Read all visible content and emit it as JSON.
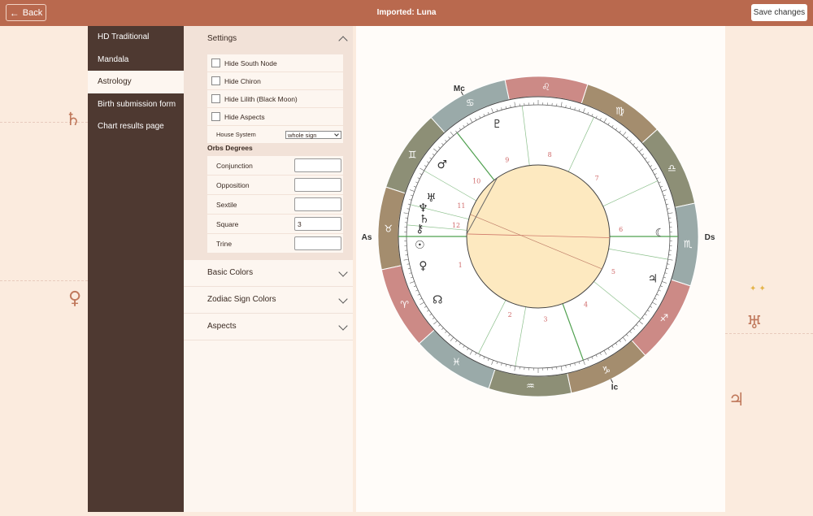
{
  "header": {
    "back_label": "Back",
    "title": "Imported: Luna",
    "save_label": "Save changes"
  },
  "nav": {
    "items": [
      {
        "label": "HD Traditional"
      },
      {
        "label": "Mandala"
      },
      {
        "label": "Astrology"
      },
      {
        "label": "Birth submission form"
      },
      {
        "label": "Chart results page"
      }
    ]
  },
  "settings": {
    "title": "Settings",
    "checkboxes": [
      {
        "label": "Hide South Node",
        "checked": false
      },
      {
        "label": "Hide Chiron",
        "checked": false
      },
      {
        "label": "Hide Lilith (Black Moon)",
        "checked": false
      },
      {
        "label": "Hide Aspects",
        "checked": false
      }
    ],
    "house_system_label": "House System",
    "house_system_value": "whole sign",
    "orbs_title": "Orbs Degrees",
    "orbs": [
      {
        "label": "Conjunction",
        "value": ""
      },
      {
        "label": "Opposition",
        "value": ""
      },
      {
        "label": "Sextile",
        "value": ""
      },
      {
        "label": "Square",
        "value": "3"
      },
      {
        "label": "Trine",
        "value": ""
      }
    ]
  },
  "sections": [
    {
      "label": "Basic Colors"
    },
    {
      "label": "Zodiac Sign Colors"
    },
    {
      "label": "Aspects"
    }
  ],
  "chart": {
    "angles": {
      "as": "As",
      "ds": "Ds",
      "mc": "Mc",
      "ic": "Ic"
    },
    "signs": [
      {
        "glyph": "♎",
        "color": "#8d8f76"
      },
      {
        "glyph": "♍",
        "color": "#a48d6e"
      },
      {
        "glyph": "♌",
        "color": "#cc8a86"
      },
      {
        "glyph": "♋",
        "color": "#9aaaa9"
      },
      {
        "glyph": "♊",
        "color": "#8d8f76"
      },
      {
        "glyph": "♉",
        "color": "#a48d6e"
      },
      {
        "glyph": "♈",
        "color": "#cc8a86"
      },
      {
        "glyph": "♓",
        "color": "#9aaaa9"
      },
      {
        "glyph": "♒",
        "color": "#8d8f76"
      },
      {
        "glyph": "♑",
        "color": "#a48d6e"
      },
      {
        "glyph": "♐",
        "color": "#cc8a86"
      },
      {
        "glyph": "♏",
        "color": "#9aaaa9"
      }
    ],
    "house_numbers": [
      "1",
      "2",
      "3",
      "4",
      "5",
      "6",
      "7",
      "8",
      "9",
      "10",
      "11",
      "12"
    ],
    "planets": [
      {
        "name": "pluto",
        "glyph": "♇"
      },
      {
        "name": "mars",
        "glyph": "♂"
      },
      {
        "name": "uranus",
        "glyph": "♅"
      },
      {
        "name": "neptune",
        "glyph": "♆"
      },
      {
        "name": "saturn",
        "glyph": "♄"
      },
      {
        "name": "chiron",
        "glyph": "⚷"
      },
      {
        "name": "sun",
        "glyph": "☉"
      },
      {
        "name": "venus",
        "glyph": "♀"
      },
      {
        "name": "north-node",
        "glyph": "☊"
      },
      {
        "name": "moon",
        "glyph": "☾"
      },
      {
        "name": "jupiter",
        "glyph": "♃"
      }
    ]
  },
  "decorations": {
    "left_top": "♄",
    "left_mid": "♀",
    "right_mid": "♅",
    "right_bottom": "♃"
  }
}
